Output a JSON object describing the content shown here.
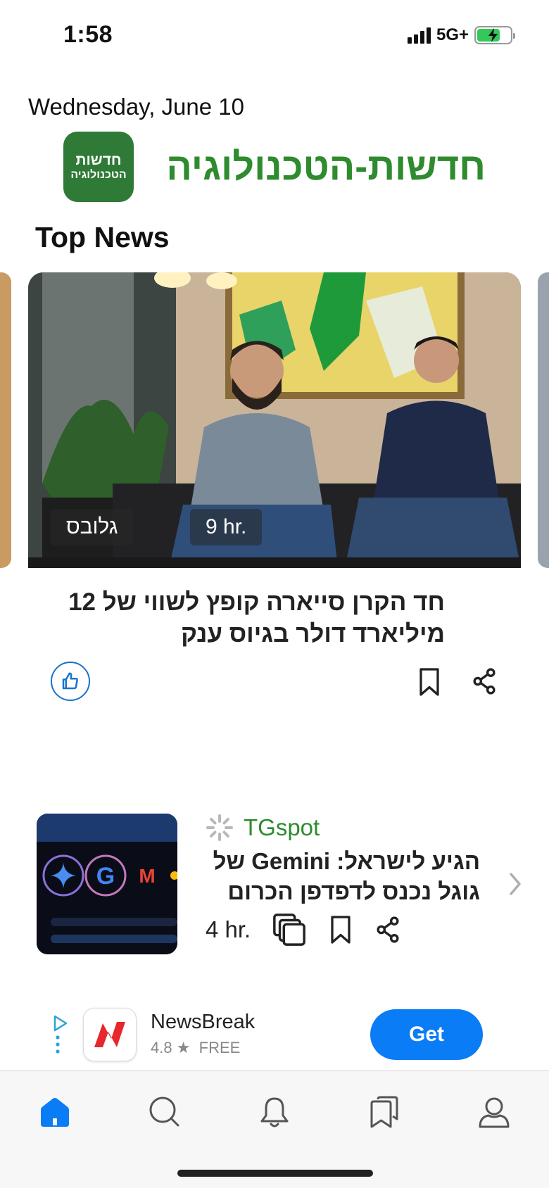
{
  "status_bar": {
    "time": "1:58",
    "network": "5G+"
  },
  "header": {
    "date": "Wednesday, June 10",
    "channel_logo_line1": "חדשות",
    "channel_logo_line2": "הטכנולוגיה",
    "channel_title": "חדשות-הטכנולוגיה"
  },
  "top_news": {
    "section_title": "Top News",
    "featured": {
      "source": "גלובס",
      "time": "9 hr.",
      "headline": "חד הקרן סייארה קופץ לשווי של 12 מיליארד דולר בגיוס ענק"
    },
    "story": {
      "source": "TGspot",
      "headline": "הגיע לישראל: Gemini של גוגל נכנס לדפדפן הכרום",
      "time": "4 hr."
    }
  },
  "ad": {
    "app_name": "NewsBreak",
    "rating": "4.8 ★",
    "price": "FREE",
    "cta": "Get"
  },
  "tab_bar": {
    "items": [
      "home",
      "search",
      "notifications",
      "following",
      "profile"
    ],
    "active": "home"
  },
  "colors": {
    "accent_green": "#2e8b2e",
    "link_blue": "#1a73c9",
    "cta_blue": "#0a7cf5"
  }
}
